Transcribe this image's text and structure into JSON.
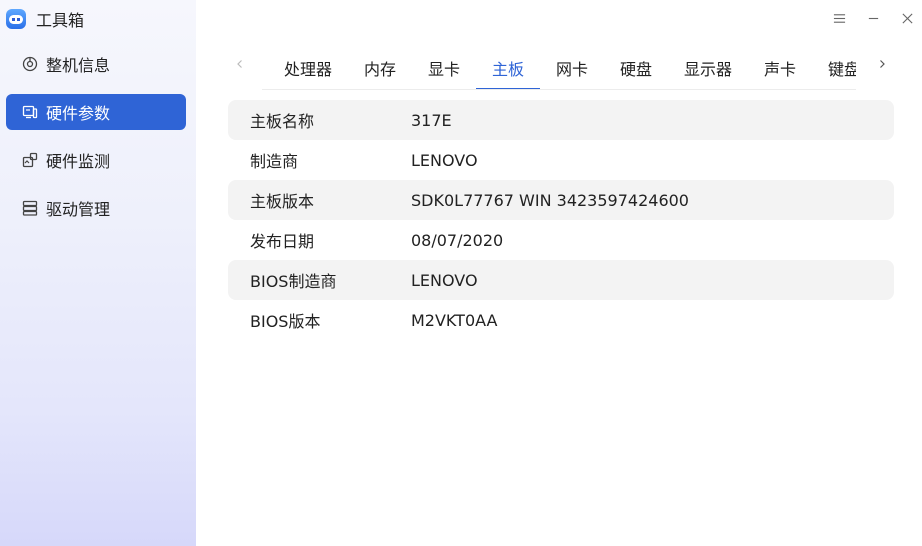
{
  "app": {
    "title": "工具箱",
    "logo_icon": "toolbox-robot-icon"
  },
  "window_controls": {
    "menu": "☰",
    "minimize": "–",
    "close": "✕"
  },
  "sidebar": {
    "items": [
      {
        "label": "整机信息",
        "icon": "machine-info-icon",
        "active": false
      },
      {
        "label": "硬件参数",
        "icon": "hardware-params-icon",
        "active": true
      },
      {
        "label": "硬件监测",
        "icon": "hardware-monitor-icon",
        "active": false
      },
      {
        "label": "驱动管理",
        "icon": "driver-manage-icon",
        "active": false
      }
    ]
  },
  "tabs": {
    "prev_icon": "chevron-left-icon",
    "next_icon": "chevron-right-icon",
    "items": [
      {
        "label": "处理器",
        "active": false
      },
      {
        "label": "内存",
        "active": false
      },
      {
        "label": "显卡",
        "active": false
      },
      {
        "label": "主板",
        "active": true
      },
      {
        "label": "网卡",
        "active": false
      },
      {
        "label": "硬盘",
        "active": false
      },
      {
        "label": "显示器",
        "active": false
      },
      {
        "label": "声卡",
        "active": false
      },
      {
        "label": "键盘",
        "active": false
      }
    ]
  },
  "board_info": {
    "rows": [
      {
        "key": "主板名称",
        "value": "317E"
      },
      {
        "key": "制造商",
        "value": "LENOVO"
      },
      {
        "key": "主板版本",
        "value": "SDK0L77767 WIN 3423597424600"
      },
      {
        "key": "发布日期",
        "value": "08/07/2020"
      },
      {
        "key": "BIOS制造商",
        "value": "LENOVO"
      },
      {
        "key": "BIOS版本",
        "value": "M2VKT0AA"
      }
    ]
  },
  "colors": {
    "accent": "#2f64d6",
    "row_shade": "#f3f3f3"
  }
}
